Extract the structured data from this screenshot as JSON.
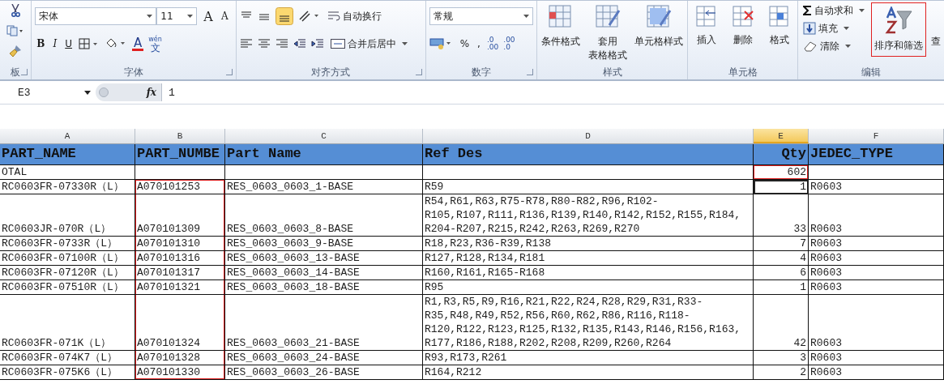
{
  "ribbon": {
    "clipboard": {
      "label": "板"
    },
    "font": {
      "label": "字体",
      "font_name": "宋体",
      "font_size": "11",
      "grow_font": "A",
      "shrink_font": "A",
      "bold": "B",
      "italic": "I",
      "underline": "U",
      "font_color": "A",
      "phonetic": [
        "wén",
        "文"
      ]
    },
    "alignment": {
      "label": "对齐方式",
      "wrap_text": "自动换行",
      "merge_center": "合并后居中"
    },
    "number": {
      "label": "数字",
      "format": "常规",
      "percent": "%",
      "comma": ",",
      "increase_decimal": [
        ".0",
        ".00"
      ],
      "decrease_decimal": [
        ".00",
        ".0"
      ]
    },
    "styles": {
      "label": "样式",
      "buttons": [
        [
          "条件格式"
        ],
        [
          "套用",
          "表格格式"
        ],
        [
          "单元格样式"
        ]
      ]
    },
    "cells": {
      "label": "单元格",
      "buttons": [
        "插入",
        "删除",
        "格式"
      ]
    },
    "editing": {
      "label": "编辑",
      "autosum": "自动求和",
      "fill": "填充",
      "clear": "清除",
      "sort_filter": {
        "label": "排序和筛选",
        "marked": true
      },
      "find": "查"
    }
  },
  "formula_bar": {
    "name_box": "E3",
    "fx": "fx",
    "formula": "1"
  },
  "sheet": {
    "columns": [
      {
        "letter": "A",
        "selected": false
      },
      {
        "letter": "B",
        "selected": false
      },
      {
        "letter": "C",
        "selected": false
      },
      {
        "letter": "D",
        "selected": false
      },
      {
        "letter": "E",
        "selected": true
      },
      {
        "letter": "F",
        "selected": false
      }
    ],
    "rows": [
      {
        "kind": "header",
        "cells": [
          {
            "text": "PART_NAME",
            "selected": false,
            "marked": false
          },
          {
            "text": "PART_NUMBE",
            "selected": false,
            "marked": false
          },
          {
            "text": "Part Name",
            "selected": false,
            "marked": false
          },
          {
            "text": "Ref Des",
            "selected": false,
            "marked": false
          },
          {
            "text": "Qty",
            "selected": false,
            "marked": false
          },
          {
            "text": "JEDEC_TYPE",
            "selected": false,
            "marked": false
          }
        ]
      },
      {
        "kind": "data",
        "cells": [
          {
            "text": "OTAL",
            "selected": false,
            "marked": false
          },
          {
            "text": "",
            "selected": false,
            "marked": false
          },
          {
            "text": "",
            "selected": false,
            "marked": false
          },
          {
            "text": "",
            "selected": false,
            "marked": false
          },
          {
            "text": "602",
            "selected": false,
            "marked": true
          },
          {
            "text": "",
            "selected": false,
            "marked": false
          }
        ]
      },
      {
        "kind": "data",
        "cells": [
          {
            "text": "RC0603FR-07330R（L）",
            "selected": false,
            "marked": false
          },
          {
            "text": "A070101253",
            "selected": false,
            "marked": true
          },
          {
            "text": "RES_0603_0603_1-BASE",
            "selected": false,
            "marked": false
          },
          {
            "text": "R59",
            "selected": false,
            "marked": false
          },
          {
            "text": "1",
            "selected": true,
            "marked": false
          },
          {
            "text": "R0603",
            "selected": false,
            "marked": false
          }
        ]
      },
      {
        "kind": "data",
        "cells": [
          {
            "text": "RC0603JR-070R（L）",
            "selected": false,
            "marked": false
          },
          {
            "text": "A070101309",
            "selected": false,
            "marked": true
          },
          {
            "text": "RES_0603_0603_8-BASE",
            "selected": false,
            "marked": false
          },
          {
            "text": "R54,R61,R63,R75-R78,R80-R82,R96,R102-\nR105,R107,R111,R136,R139,R140,R142,R152,R155,R184,\nR204-R207,R215,R242,R263,R269,R270",
            "selected": false,
            "marked": false
          },
          {
            "text": "33",
            "selected": false,
            "marked": false
          },
          {
            "text": "R0603",
            "selected": false,
            "marked": false
          }
        ]
      },
      {
        "kind": "data",
        "cells": [
          {
            "text": "RC0603FR-0733R（L）",
            "selected": false,
            "marked": false
          },
          {
            "text": "A070101310",
            "selected": false,
            "marked": true
          },
          {
            "text": "RES_0603_0603_9-BASE",
            "selected": false,
            "marked": false
          },
          {
            "text": "R18,R23,R36-R39,R138",
            "selected": false,
            "marked": false
          },
          {
            "text": "7",
            "selected": false,
            "marked": false
          },
          {
            "text": "R0603",
            "selected": false,
            "marked": false
          }
        ]
      },
      {
        "kind": "data",
        "cells": [
          {
            "text": "RC0603FR-07100R（L）",
            "selected": false,
            "marked": false
          },
          {
            "text": "A070101316",
            "selected": false,
            "marked": true
          },
          {
            "text": "RES_0603_0603_13-BASE",
            "selected": false,
            "marked": false
          },
          {
            "text": "R127,R128,R134,R181",
            "selected": false,
            "marked": false
          },
          {
            "text": "4",
            "selected": false,
            "marked": false
          },
          {
            "text": "R0603",
            "selected": false,
            "marked": false
          }
        ]
      },
      {
        "kind": "data",
        "cells": [
          {
            "text": "RC0603FR-07120R（L）",
            "selected": false,
            "marked": false
          },
          {
            "text": "A070101317",
            "selected": false,
            "marked": true
          },
          {
            "text": "RES_0603_0603_14-BASE",
            "selected": false,
            "marked": false
          },
          {
            "text": "R160,R161,R165-R168",
            "selected": false,
            "marked": false
          },
          {
            "text": "6",
            "selected": false,
            "marked": false
          },
          {
            "text": "R0603",
            "selected": false,
            "marked": false
          }
        ]
      },
      {
        "kind": "data",
        "cells": [
          {
            "text": "RC0603FR-07510R（L）",
            "selected": false,
            "marked": false
          },
          {
            "text": "A070101321",
            "selected": false,
            "marked": true
          },
          {
            "text": "RES_0603_0603_18-BASE",
            "selected": false,
            "marked": false
          },
          {
            "text": "R95",
            "selected": false,
            "marked": false
          },
          {
            "text": "1",
            "selected": false,
            "marked": false
          },
          {
            "text": "R0603",
            "selected": false,
            "marked": false
          }
        ]
      },
      {
        "kind": "data",
        "cells": [
          {
            "text": "RC0603FR-071K（L）",
            "selected": false,
            "marked": false
          },
          {
            "text": "A070101324",
            "selected": false,
            "marked": true
          },
          {
            "text": "RES_0603_0603_21-BASE",
            "selected": false,
            "marked": false
          },
          {
            "text": "R1,R3,R5,R9,R16,R21,R22,R24,R28,R29,R31,R33-\nR35,R48,R49,R52,R56,R60,R62,R86,R116,R118-\nR120,R122,R123,R125,R132,R135,R143,R146,R156,R163,\nR177,R186,R188,R202,R208,R209,R260,R264",
            "selected": false,
            "marked": false
          },
          {
            "text": "42",
            "selected": false,
            "marked": false
          },
          {
            "text": "R0603",
            "selected": false,
            "marked": false
          }
        ]
      },
      {
        "kind": "data",
        "cells": [
          {
            "text": "RC0603FR-074K7（L）",
            "selected": false,
            "marked": false
          },
          {
            "text": "A070101328",
            "selected": false,
            "marked": true
          },
          {
            "text": "RES_0603_0603_24-BASE",
            "selected": false,
            "marked": false
          },
          {
            "text": "R93,R173,R261",
            "selected": false,
            "marked": false
          },
          {
            "text": "3",
            "selected": false,
            "marked": false
          },
          {
            "text": "R0603",
            "selected": false,
            "marked": false
          }
        ]
      },
      {
        "kind": "data",
        "cells": [
          {
            "text": "RC0603FR-075K6（L）",
            "selected": false,
            "marked": false
          },
          {
            "text": "A070101330",
            "selected": false,
            "marked": true
          },
          {
            "text": "RES_0603_0603_26-BASE",
            "selected": false,
            "marked": false
          },
          {
            "text": "R164,R212",
            "selected": false,
            "marked": false
          },
          {
            "text": "2",
            "selected": false,
            "marked": false
          },
          {
            "text": "R0603",
            "selected": false,
            "marked": false
          }
        ]
      }
    ]
  }
}
